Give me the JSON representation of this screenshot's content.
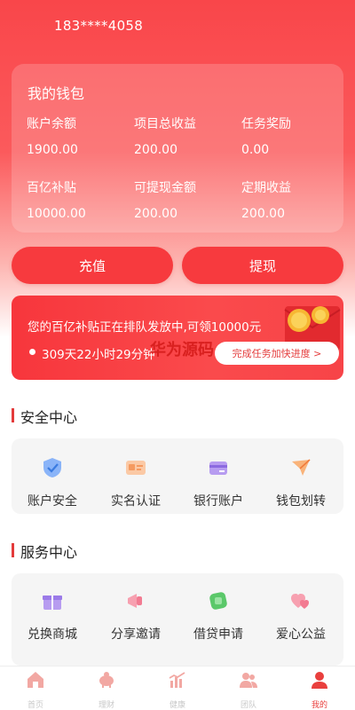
{
  "header": {
    "phone": "183****4058"
  },
  "wallet": {
    "title": "我的钱包",
    "stats": [
      {
        "label": "账户余额",
        "value": "1900.00"
      },
      {
        "label": "项目总收益",
        "value": "200.00"
      },
      {
        "label": "任务奖励",
        "value": "0.00"
      },
      {
        "label": "百亿补贴",
        "value": "10000.00"
      },
      {
        "label": "可提现金额",
        "value": "200.00"
      },
      {
        "label": "定期收益",
        "value": "200.00"
      }
    ]
  },
  "actions": {
    "recharge": "充值",
    "withdraw": "提现"
  },
  "promo": {
    "text": "您的百亿补贴正在排队发放中,可领10000元",
    "timer": "309天22小时29分钟",
    "watermark": "华为源码",
    "button": "完成任务加快进度 >"
  },
  "security": {
    "title": "安全中心",
    "items": [
      {
        "label": "账户安全",
        "icon": "shield-check-icon"
      },
      {
        "label": "实名认证",
        "icon": "id-card-icon"
      },
      {
        "label": "银行账户",
        "icon": "bank-card-icon"
      },
      {
        "label": "钱包划转",
        "icon": "paper-plane-icon"
      }
    ]
  },
  "service": {
    "title": "服务中心",
    "items": [
      {
        "label": "兑换商城",
        "icon": "gift-box-icon"
      },
      {
        "label": "分享邀请",
        "icon": "megaphone-icon"
      },
      {
        "label": "借贷申请",
        "icon": "loan-cube-icon"
      },
      {
        "label": "爱心公益",
        "icon": "hearts-icon"
      }
    ]
  },
  "tabbar": [
    {
      "label": "首页",
      "icon": "home-icon"
    },
    {
      "label": "理财",
      "icon": "piggy-bank-icon"
    },
    {
      "label": "健康",
      "icon": "health-chart-icon"
    },
    {
      "label": "团队",
      "icon": "team-icon"
    },
    {
      "label": "我的",
      "icon": "user-icon",
      "active": true
    }
  ],
  "colors": {
    "primary": "#f9464a",
    "accent": "#e9403e"
  }
}
